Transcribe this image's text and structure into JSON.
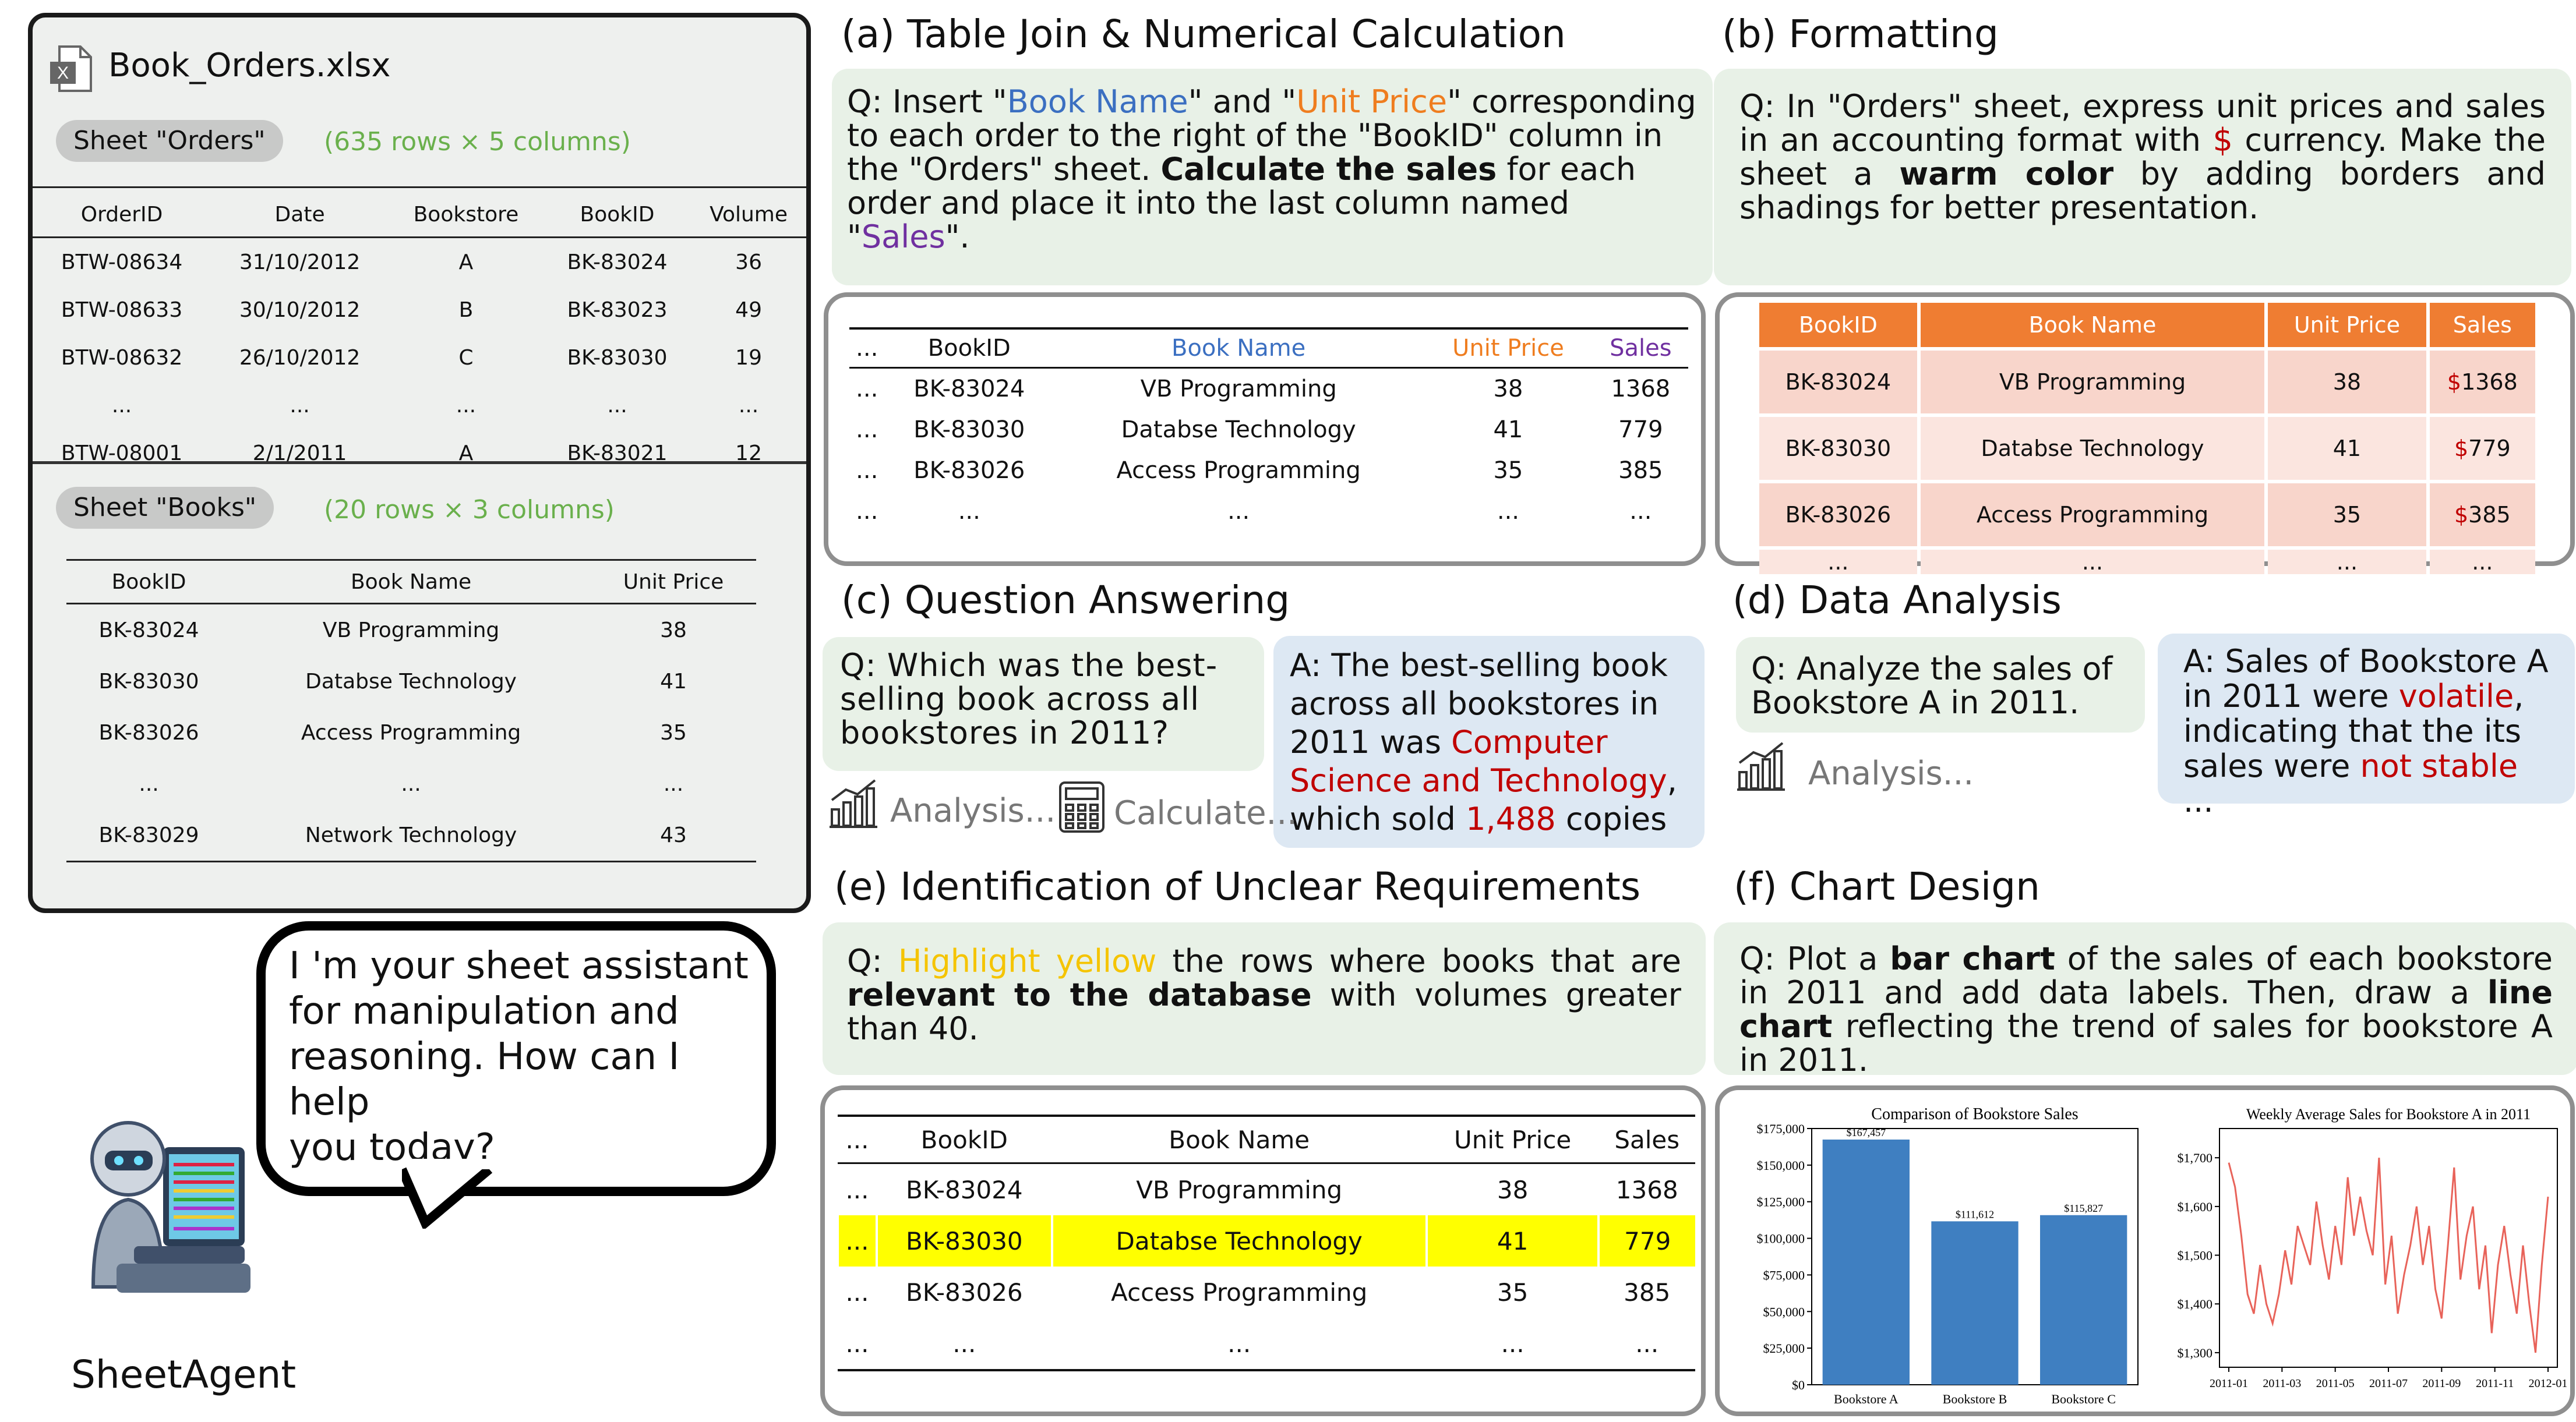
{
  "left_panel": {
    "file_name": "Book_Orders.xlsx",
    "file_icon": "excel-file-icon",
    "orders_sheet": {
      "label": "Sheet \"Orders\"",
      "dims": "(635 rows × 5 columns)",
      "headers": [
        "OrderID",
        "Date",
        "Bookstore",
        "BookID",
        "Volume"
      ],
      "rows": [
        [
          "BTW-08634",
          "31/10/2012",
          "A",
          "BK-83024",
          "36"
        ],
        [
          "BTW-08633",
          "30/10/2012",
          "B",
          "BK-83023",
          "49"
        ],
        [
          "BTW-08632",
          "26/10/2012",
          "C",
          "BK-83030",
          "19"
        ],
        [
          "...",
          "...",
          "...",
          "...",
          "..."
        ],
        [
          "BTW-08001",
          "2/1/2011",
          "A",
          "BK-83021",
          "12"
        ]
      ]
    },
    "books_sheet": {
      "label": "Sheet \"Books\"",
      "dims": "(20 rows × 3 columns)",
      "headers": [
        "BookID",
        "Book Name",
        "Unit Price"
      ],
      "rows": [
        [
          "BK-83024",
          "VB Programming",
          "38"
        ],
        [
          "BK-83030",
          "Databse Technology",
          "41"
        ],
        [
          "BK-83026",
          "Access Programming",
          "35"
        ],
        [
          "...",
          "...",
          "..."
        ],
        [
          "BK-83029",
          "Network Technology",
          "43"
        ]
      ]
    }
  },
  "agent": {
    "bubble_lines": [
      "I  'm your sheet assistant",
      "for manipulation and",
      "reasoning. How can I help",
      "you today?"
    ],
    "name": "SheetAgent"
  },
  "task_a": {
    "title": "(a) Table Join & Numerical Calculation",
    "q": {
      "p1": "Q: Insert \"",
      "book_name": "Book Name",
      "p2": "\" and \"",
      "unit_price": "Unit Price",
      "p3": "\" corresponding to each order to the right of the \"BookID\" column in the \"Orders\" sheet. ",
      "bold": "Calculate the sales",
      "p4": " for each order and place it into the last column named \"",
      "sales": "Sales",
      "p5": "\"."
    },
    "headers": [
      "...",
      "BookID",
      "Book Name",
      "Unit Price",
      "Sales"
    ],
    "rows": [
      [
        "...",
        "BK-83024",
        "VB  Programming",
        "38",
        "1368"
      ],
      [
        "...",
        "BK-83030",
        "Databse Technology",
        "41",
        "779"
      ],
      [
        "...",
        "BK-83026",
        "Access Programming",
        "35",
        "385"
      ],
      [
        "...",
        "...",
        "...",
        "...",
        "..."
      ]
    ]
  },
  "task_b": {
    "title": "(b) Formatting",
    "q": {
      "p1": "Q: In \"Orders\" sheet, express unit prices and sales in an accounting format with ",
      "dollar": "$",
      "p2": " currency. Make the sheet a ",
      "bold": "warm color",
      "p3": " by adding borders and shadings for better presentation."
    },
    "headers": [
      "BookID",
      "Book Name",
      "Unit Price",
      "Sales"
    ],
    "currency": "$",
    "rows": [
      [
        "BK-83024",
        "VB  Programming",
        "38",
        "1368"
      ],
      [
        "BK-83030",
        "Databse Technology",
        "41",
        "779"
      ],
      [
        "BK-83026",
        "Access Programming",
        "35",
        "385"
      ],
      [
        "...",
        "...",
        "...",
        "..."
      ]
    ]
  },
  "task_c": {
    "title": "(c) Question Answering",
    "q": "Q: Which was the best-selling book across all bookstores in 2011?",
    "a": {
      "p1": "A: The best-selling book across all bookstores in 2011 was ",
      "book": "Computer Science and Technology",
      "p2": ", which sold ",
      "copies": "1,488",
      "p3": " copies"
    },
    "analysis": "Analysis...",
    "calculate": "Calculate..."
  },
  "task_d": {
    "title": "(d) Data Analysis",
    "q": "Q: Analyze the sales of Bookstore A in 2011.",
    "analysis": "Analysis...",
    "a": {
      "p1": "A: Sales of Bookstore A in 2011 were ",
      "volatile": "volatile",
      "p2": ", indicating that the its sales were ",
      "not_stable": "not stable",
      "p3": " ..."
    }
  },
  "task_e": {
    "title": "(e) Identification of Unclear Requirements",
    "q": {
      "p1": "Q: ",
      "highlight": "Highlight yellow",
      "p2": " the rows where books that are ",
      "bold": "relevant to the database",
      "p3": " with volumes greater than 40."
    },
    "headers": [
      "...",
      "BookID",
      "Book Name",
      "Unit Price",
      "Sales"
    ],
    "rows": [
      [
        "...",
        "BK-83024",
        "VB  Programming",
        "38",
        "1368"
      ],
      [
        "...",
        "BK-83030",
        "Databse Technology",
        "41",
        "779"
      ],
      [
        "...",
        "BK-83026",
        "Access Programming",
        "35",
        "385"
      ],
      [
        "...",
        "...",
        "...",
        "...",
        "..."
      ]
    ],
    "highlighted_row": 1,
    "highlight_color": "#ffff00"
  },
  "task_f": {
    "title": "(f) Chart Design",
    "q": {
      "p1": "Q: Plot a ",
      "bar": "bar chart",
      "p2": " of the sales of each bookstore in 2011 and add data labels. Then, draw a ",
      "line": "line chart",
      "p3": " reflecting the trend of sales for bookstore A in 2011."
    }
  },
  "chart_data": [
    {
      "type": "bar",
      "title": "Comparison of Bookstore Sales",
      "categories": [
        "Bookstore A",
        "Bookstore B",
        "Bookstore C"
      ],
      "values": [
        167457,
        111612,
        115827
      ],
      "data_labels": [
        "$167,457",
        "$111,612",
        "$115,827"
      ],
      "yticks": [
        "$0",
        "$25,000",
        "$50,000",
        "$75,000",
        "$100,000",
        "$125,000",
        "$150,000",
        "$175,000"
      ],
      "ylim": [
        0,
        175000
      ],
      "color": "#3f7fc1"
    },
    {
      "type": "line",
      "title": "Weekly Average Sales for Bookstore A in 2011",
      "xticks": [
        "2011-01",
        "2011-03",
        "2011-05",
        "2011-07",
        "2011-09",
        "2011-11",
        "2012-01"
      ],
      "yticks": [
        "$1,300",
        "$1,400",
        "$1,500",
        "$1,600",
        "$1,700"
      ],
      "ylim": [
        1270,
        1760
      ],
      "color": "#e8635a",
      "values": [
        1690,
        1640,
        1540,
        1420,
        1380,
        1480,
        1400,
        1360,
        1420,
        1510,
        1440,
        1560,
        1520,
        1480,
        1610,
        1520,
        1450,
        1560,
        1480,
        1660,
        1540,
        1620,
        1550,
        1500,
        1700,
        1440,
        1540,
        1380,
        1460,
        1520,
        1600,
        1480,
        1560,
        1430,
        1370,
        1520,
        1680,
        1450,
        1540,
        1600,
        1430,
        1520,
        1340,
        1480,
        1560,
        1460,
        1380,
        1520,
        1400,
        1300,
        1480,
        1620
      ]
    }
  ]
}
